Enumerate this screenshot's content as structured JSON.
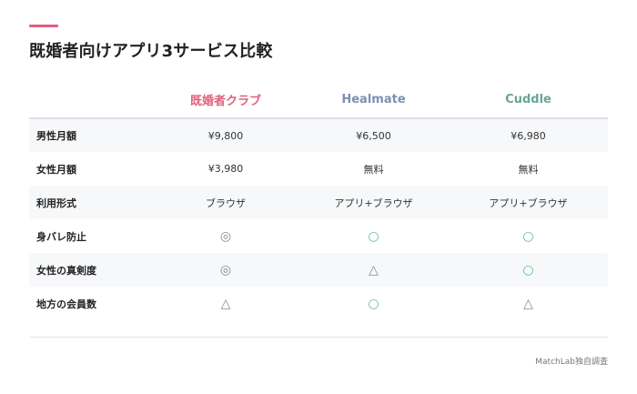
{
  "title": "既婚者向けアプリ3サービス比較",
  "columns": [
    {
      "name": "既婚者クラブ",
      "color": "#e0607e"
    },
    {
      "name": "Healmate",
      "color": "#7b8fb3"
    },
    {
      "name": "Cuddle",
      "color": "#6ba397"
    }
  ],
  "rows": [
    {
      "label": "男性月額",
      "values": [
        "¥9,800",
        "¥6,500",
        "¥6,980"
      ]
    },
    {
      "label": "女性月額",
      "values": [
        "¥3,980",
        "無料",
        "無料"
      ]
    },
    {
      "label": "利用形式",
      "values": [
        "ブラウザ",
        "アプリ+ブラウザ",
        "アプリ+ブラウザ"
      ]
    },
    {
      "label": "身バレ防止",
      "values": [
        "◎",
        "○",
        "○"
      ]
    },
    {
      "label": "女性の真剣度",
      "values": [
        "◎",
        "△",
        "○"
      ]
    },
    {
      "label": "地方の会員数",
      "values": [
        "△",
        "○",
        "△"
      ]
    }
  ],
  "source": "MatchLab独自調査",
  "colors": {
    "accent": "#e0607e",
    "good_mark": "#5fbf8f"
  }
}
